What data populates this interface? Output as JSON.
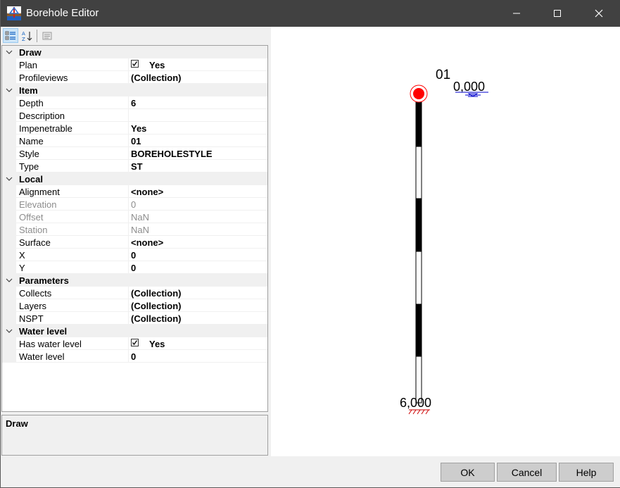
{
  "window": {
    "title": "Borehole Editor"
  },
  "toolbar": {
    "categorized_icon": "categorized-view-icon",
    "alphabetical_icon": "alphabetical-sort-icon",
    "property_pages_icon": "property-pages-icon"
  },
  "grid": {
    "draw": {
      "label": "Draw",
      "plan": {
        "name": "Plan",
        "value": "Yes",
        "checked": true
      },
      "profileviews": {
        "name": "Profileviews",
        "value": "(Collection)"
      }
    },
    "item": {
      "label": "Item",
      "depth": {
        "name": "Depth",
        "value": "6"
      },
      "description": {
        "name": "Description",
        "value": ""
      },
      "impenetrable": {
        "name": "Impenetrable",
        "value": "Yes"
      },
      "name": {
        "name": "Name",
        "value": "01"
      },
      "style": {
        "name": "Style",
        "value": "BOREHOLESTYLE"
      },
      "type": {
        "name": "Type",
        "value": "ST"
      }
    },
    "local": {
      "label": "Local",
      "alignment": {
        "name": "Alignment",
        "value": "<none>"
      },
      "elevation": {
        "name": "Elevation",
        "value": "0"
      },
      "offset": {
        "name": "Offset",
        "value": "NaN"
      },
      "station": {
        "name": "Station",
        "value": "NaN"
      },
      "surface": {
        "name": "Surface",
        "value": "<none>"
      },
      "x": {
        "name": "X",
        "value": "0"
      },
      "y": {
        "name": "Y",
        "value": "0"
      }
    },
    "parameters": {
      "label": "Parameters",
      "collects": {
        "name": "Collects",
        "value": "(Collection)"
      },
      "layers": {
        "name": "Layers",
        "value": "(Collection)"
      },
      "nspt": {
        "name": "NSPT",
        "value": "(Collection)"
      }
    },
    "water_level": {
      "label": "Water level",
      "has_water_level": {
        "name": "Has water level",
        "value": "Yes",
        "checked": true
      },
      "water_level": {
        "name": "Water level",
        "value": "0"
      }
    }
  },
  "description_panel": {
    "title": "Draw"
  },
  "preview": {
    "borehole_name": "01",
    "top_elevation": "0,000",
    "bottom_depth": "6,000",
    "colors": {
      "collar": "#ff0000",
      "segment_dark": "#000000",
      "segment_light": "#ffffff",
      "water_marker": "#0000cc"
    }
  },
  "buttons": {
    "ok": "OK",
    "cancel": "Cancel",
    "help": "Help"
  }
}
